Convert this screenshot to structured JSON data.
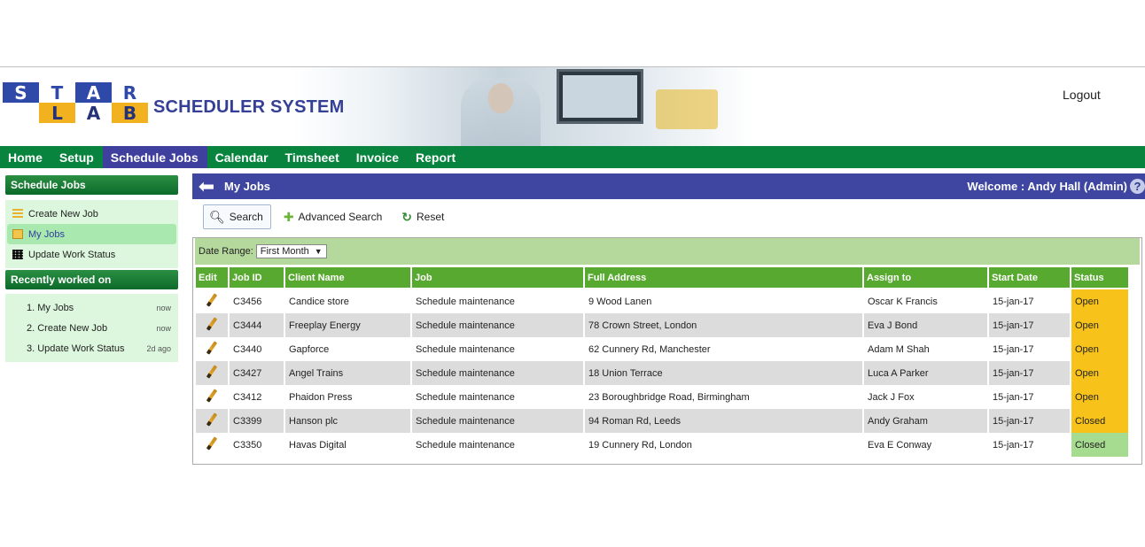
{
  "brand": {
    "logo_top": [
      "S",
      "T",
      "A",
      "R"
    ],
    "logo_bottom": [
      "L",
      "A",
      "B"
    ],
    "system_name": "SCHEDULER SYSTEM",
    "logout": "Logout"
  },
  "nav": {
    "items": [
      "Home",
      "Setup",
      "Schedule Jobs",
      "Calendar",
      "Timsheet",
      "Invoice",
      "Report"
    ],
    "active": "Schedule Jobs"
  },
  "sidebar": {
    "section_title": "Schedule Jobs",
    "items": [
      {
        "label": "Create New Job",
        "icon": "list-icon"
      },
      {
        "label": "My Jobs",
        "icon": "document-icon",
        "active": true
      },
      {
        "label": "Update Work Status",
        "icon": "grid-icon"
      }
    ],
    "recent_title": "Recently worked on",
    "recent": [
      {
        "label": "1. My Jobs",
        "when": "now"
      },
      {
        "label": "2. Create New Job",
        "when": "now"
      },
      {
        "label": "3. Update Work Status",
        "when": "2d ago"
      }
    ]
  },
  "main": {
    "title": "My Jobs",
    "welcome": "Welcome : Andy Hall (Admin)",
    "help": "?",
    "toolbar": {
      "search": "Search",
      "advanced": "Advanced Search",
      "reset": "Reset"
    },
    "filter": {
      "label": "Date Range:",
      "value": "First Month"
    },
    "columns": [
      "Edit",
      "Job ID",
      "Client Name",
      "Job",
      "Full Address",
      "Assign to",
      "Start Date",
      "Status"
    ],
    "rows": [
      {
        "id": "C3456",
        "client": "Candice store",
        "job": "Schedule maintenance",
        "address": "9 Wood Lanen",
        "assign": "Oscar K Francis",
        "date": "15-jan-17",
        "status": "Open"
      },
      {
        "id": "C3444",
        "client": "Freeplay Energy",
        "job": "Schedule maintenance",
        "address": "78 Crown Street, London",
        "assign": "Eva J Bond",
        "date": "15-jan-17",
        "status": "Open"
      },
      {
        "id": "C3440",
        "client": "Gapforce",
        "job": "Schedule maintenance",
        "address": "62 Cunnery Rd, Manchester",
        "assign": "Adam M Shah",
        "date": "15-jan-17",
        "status": "Open"
      },
      {
        "id": "C3427",
        "client": "Angel Trains",
        "job": "Schedule maintenance",
        "address": "18 Union Terrace",
        "assign": "Luca A Parker",
        "date": "15-jan-17",
        "status": "Open"
      },
      {
        "id": "C3412",
        "client": "Phaidon Press",
        "job": "Schedule maintenance",
        "address": "23 Boroughbridge Road, Birmingham",
        "assign": "Jack J Fox",
        "date": "15-jan-17",
        "status": "Open"
      },
      {
        "id": "C3399",
        "client": "Hanson plc",
        "job": "Schedule maintenance",
        "address": "94 Roman Rd, Leeds",
        "assign": "Andy Graham",
        "date": "15-jan-17",
        "status": "Closed"
      },
      {
        "id": "C3350",
        "client": "Havas Digital",
        "job": "Schedule maintenance",
        "address": "19 Cunnery Rd, London",
        "assign": "Eva E Conway",
        "date": "15-jan-17",
        "status": "Closed"
      }
    ],
    "status_colors": {
      "open": "#f7c21a",
      "closed_yellow": "#f7c21a",
      "closed_green": "#a6dc8f"
    }
  }
}
